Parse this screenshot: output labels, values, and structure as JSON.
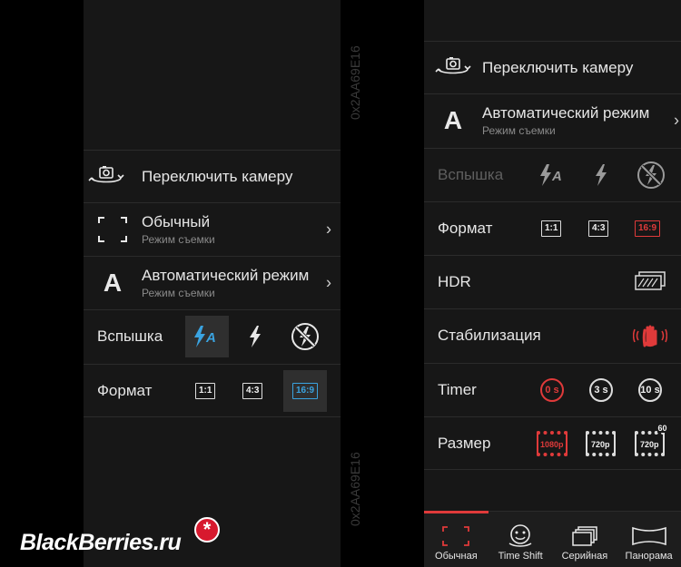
{
  "left": {
    "switch_camera": "Переключить камеру",
    "mode": {
      "title": "Обычный",
      "subtitle": "Режим съемки"
    },
    "scene": {
      "title": "Автоматический режим",
      "subtitle": "Режим съемки",
      "icon_letter": "A"
    },
    "flash_label": "Вспышка",
    "format_label": "Формат",
    "formats": [
      "1:1",
      "4:3",
      "16:9"
    ],
    "selected_format": "16:9"
  },
  "right": {
    "switch_camera": "Переключить камеру",
    "scene": {
      "title": "Автоматический режим",
      "subtitle": "Режим съемки",
      "icon_letter": "A"
    },
    "flash_label": "Вспышка",
    "format_label": "Формат",
    "formats": [
      "1:1",
      "4:3",
      "16:9"
    ],
    "selected_format": "16:9",
    "hdr_label": "HDR",
    "stabilization_label": "Стабилизация",
    "timer_label": "Timer",
    "timers": [
      "0 s",
      "3 s",
      "10 s"
    ],
    "size_label": "Размер",
    "sizes": [
      "1080p",
      "720p",
      "720p"
    ],
    "size_fps_badge": "60",
    "tabs": [
      "Обычная",
      "Time Shift",
      "Серийная",
      "Панорама"
    ]
  },
  "watermark": "0x2AA69E16",
  "brand": "BlackBerries.ru",
  "brand_star": "*",
  "colors": {
    "accent_blue": "#3aa3e0",
    "accent_red": "#e03a3a",
    "panel_bg": "#171717"
  }
}
